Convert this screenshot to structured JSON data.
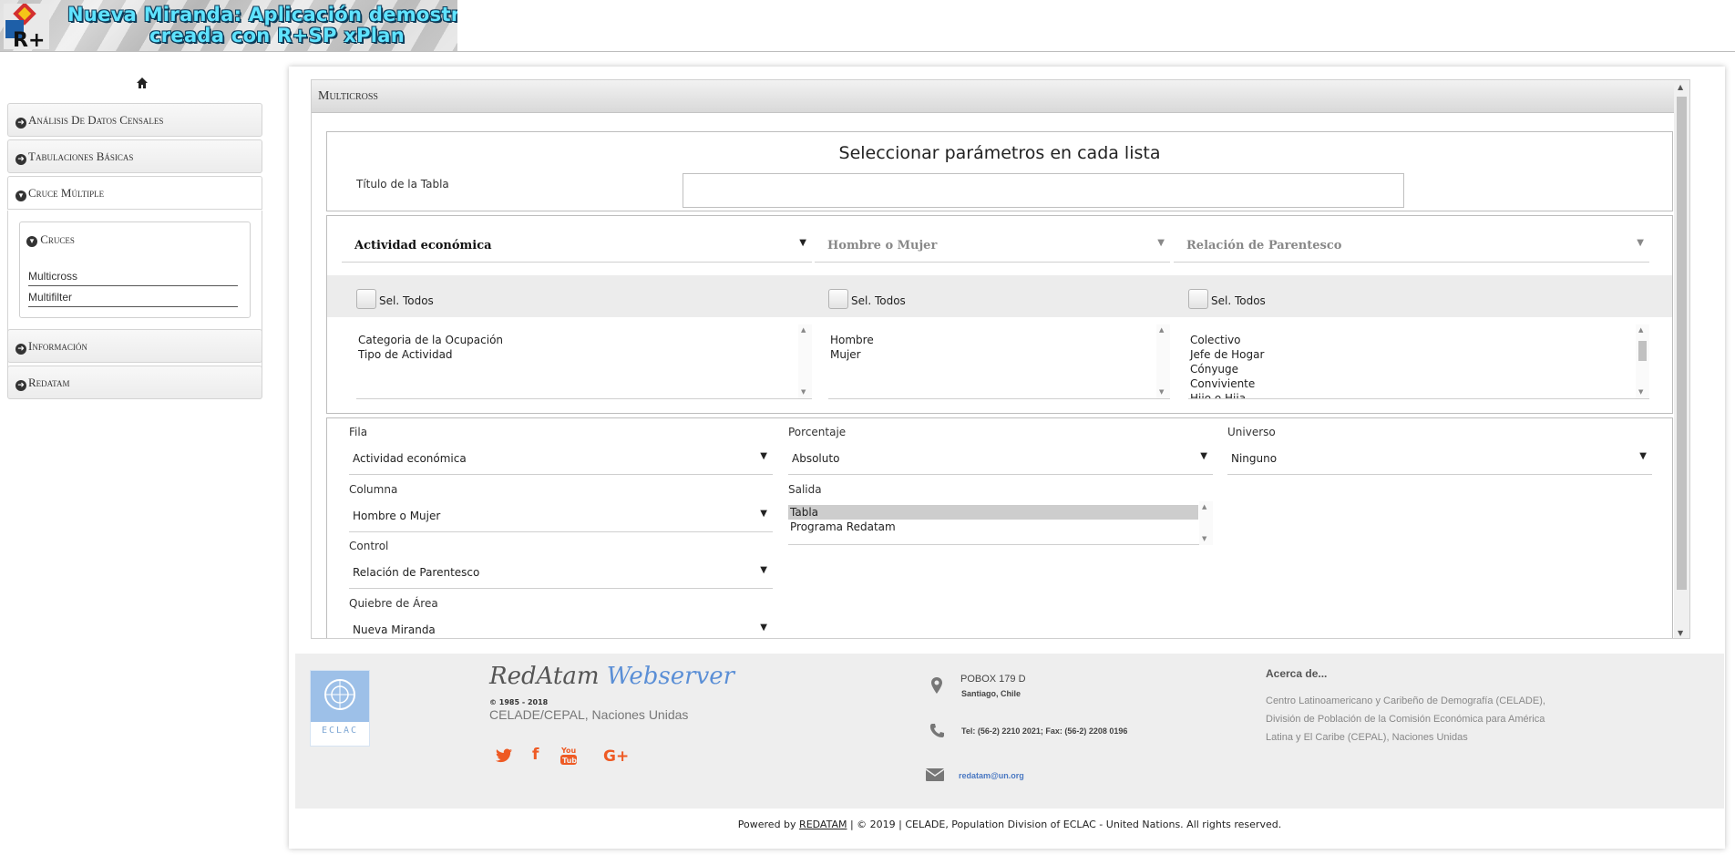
{
  "header": {
    "title_line1": "Nueva Miranda: Aplicación demostrativa",
    "title_line2": "creada con R+SP xPlan",
    "logo_text": "R+"
  },
  "sidebar": {
    "items": [
      {
        "label": "Análisis De Datos Censales"
      },
      {
        "label": "Tabulaciones Básicas"
      },
      {
        "label": "Cruce Múltiple"
      },
      {
        "label": "Información"
      },
      {
        "label": "Redatam"
      }
    ],
    "cruces_label": "Cruces",
    "sub_links": [
      "Multicross",
      "Multifilter"
    ]
  },
  "panel": {
    "heading": "Multicross",
    "select_title": "Seleccionar parámetros en cada lista",
    "table_title_label": "Título de la Tabla",
    "table_title_value": "",
    "variables": [
      {
        "selected": "Actividad económica",
        "select_all": "Sel. Todos",
        "options": [
          "Categoria de la Ocupación",
          "Tipo de Actividad"
        ]
      },
      {
        "selected": "Hombre o Mujer",
        "select_all": "Sel. Todos",
        "options": [
          "Hombre",
          "Mujer"
        ]
      },
      {
        "selected": "Relación de Parentesco",
        "select_all": "Sel. Todos",
        "options": [
          "Colectivo",
          "Jefe de Hogar",
          "Cónyuge",
          "Conviviente",
          "Hijo o Hija"
        ]
      }
    ],
    "form": {
      "fila_label": "Fila",
      "fila_value": "Actividad económica",
      "porcentaje_label": "Porcentaje",
      "porcentaje_value": "Absoluto",
      "universo_label": "Universo",
      "universo_value": "Ninguno",
      "columna_label": "Columna",
      "columna_value": "Hombre o Mujer",
      "salida_label": "Salida",
      "salida_options": [
        "Tabla",
        "Programa Redatam"
      ],
      "control_label": "Control",
      "control_value": "Relación de Parentesco",
      "quiebre_label": "Quiebre de Área",
      "quiebre_value": "Nueva Miranda"
    }
  },
  "footer": {
    "un_logo_text": "ECLAC",
    "brand_a": "RedAtam",
    "brand_b": "Webserver",
    "copyright_years": "© 1985 - 2018",
    "org": "CELADE/CEPAL, Naciones Unidas",
    "address_line1": "POBOX 179 D",
    "address_line2": "Santiago, Chile",
    "phone": "Tel: (56-2) 2210 2021; Fax: (56-2) 2208 0196",
    "email": "redatam@un.org",
    "about_heading": "Acerca de...",
    "about_text": "Centro Latinoamericano y Caribeño de Demografía (CELADE), División de Población de la Comisión Económica para América Latina y El Caribe (CEPAL), Naciones Unidas",
    "powered_prefix": "Powered by",
    "powered_link": "REDATAM",
    "powered_suffix": "| © 2019 | CELADE, Population Division of ECLAC - United Nations. All rights reserved.",
    "social_icons": [
      "twitter-icon",
      "facebook-icon",
      "youtube-icon",
      "google-plus-icon"
    ]
  },
  "colors": {
    "accent_orange": "#ee5a24",
    "brand_blue": "#5b8fd6",
    "banner_text": "#5fe3ff"
  }
}
